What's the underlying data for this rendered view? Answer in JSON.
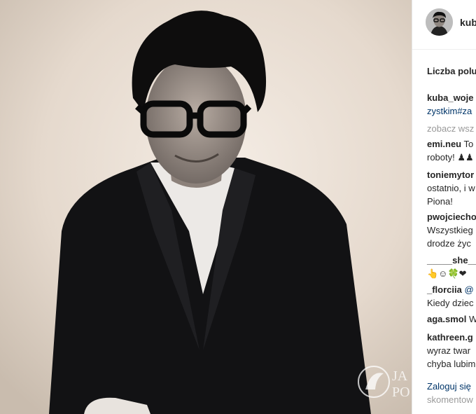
{
  "post": {
    "owner_username": "kuba",
    "likes_label": "Liczba polu",
    "caption": {
      "username": "kuba_woje",
      "hashtags": "zystkim#za"
    },
    "see_all": "zobacz wsz",
    "comments": [
      {
        "username": "emi.neu",
        "lines": [
          " To",
          "roboty! ♟♟"
        ]
      },
      {
        "username": "toniemytor",
        "lines": [
          "",
          "ostatnio, i w",
          "Piona!"
        ]
      },
      {
        "username": "pwojciecho",
        "lines": [
          "",
          "Wszystkieg",
          "drodze życ"
        ]
      },
      {
        "username": "_____she__",
        "lines": [
          "",
          "👆☺🍀❤"
        ]
      },
      {
        "username": "_florciia",
        "mention": " @",
        "lines": [
          "",
          "Kiedy dziec"
        ]
      },
      {
        "username": "aga.smol",
        "lines": [
          " W"
        ]
      },
      {
        "username": "kathreen.g",
        "lines": [
          "",
          "wyraz twar",
          "chyba lubim"
        ]
      }
    ],
    "login_prompt": {
      "link": "Zaloguj się",
      "rest": "skomentow"
    }
  },
  "watermark": {
    "line1": "JA",
    "line2": "PO"
  },
  "colors": {
    "link": "#003569",
    "text": "#262626",
    "muted": "#999999",
    "photo_bg": "#e9ded4"
  }
}
